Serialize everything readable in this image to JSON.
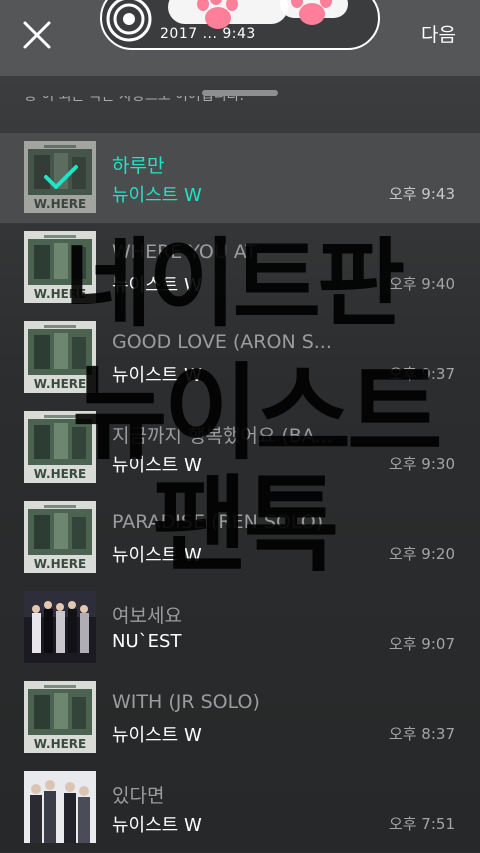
{
  "header": {
    "close_icon": "close-icon",
    "playing_label": "2017 ... 9:43",
    "next_label": "다음",
    "colors": {
      "bar": "#545657",
      "accent": "#1ee5c6"
    }
  },
  "sheet": {
    "hint_text": "송 이 되는 곡은 자동으로 이어집니다."
  },
  "tracks": [
    {
      "title": "하루만",
      "artist": "뉴이스트 W",
      "time": "오후 9:43",
      "selected": true,
      "cover": "where"
    },
    {
      "title": "WHERE YOU AT",
      "artist": "뉴이스트 W",
      "time": "오후 9:40",
      "selected": false,
      "cover": "where"
    },
    {
      "title": "GOOD LOVE (ARON S...",
      "artist": "뉴이스트 W",
      "time": "오후 9:37",
      "selected": false,
      "cover": "where"
    },
    {
      "title": "지금까지 행복했어요 (BA...",
      "artist": "뉴이스트 W",
      "time": "오후 9:30",
      "selected": false,
      "cover": "where"
    },
    {
      "title": "PARADISE (REN SOLO)",
      "artist": "뉴이스트 W",
      "time": "오후 9:20",
      "selected": false,
      "cover": "where"
    },
    {
      "title": "여보세요",
      "artist": "NU`EST",
      "time": "오후 9:07",
      "selected": false,
      "cover": "group-dark"
    },
    {
      "title": "WITH (JR SOLO)",
      "artist": "뉴이스트 W",
      "time": "오후 8:37",
      "selected": false,
      "cover": "where"
    },
    {
      "title": "있다면",
      "artist": "뉴이스트 W",
      "time": "오후 7:51",
      "selected": false,
      "cover": "group-light"
    }
  ],
  "overlay_text": {
    "line1": "네이트판",
    "line2": "뉴이스트",
    "line3": "팬톡"
  }
}
